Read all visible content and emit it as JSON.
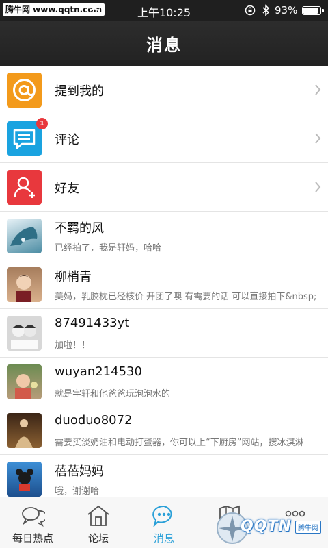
{
  "status_bar": {
    "site_label": "腾牛网 www.qqtn.com",
    "time": "上午10:25",
    "battery_pct": "93%",
    "battery_level": 0.93
  },
  "header": {
    "title": "消息"
  },
  "menu": [
    {
      "label": "提到我的",
      "icon": "at-icon",
      "color": "#f39a1b"
    },
    {
      "label": "评论",
      "icon": "comment-icon",
      "color": "#1aa3e0",
      "badge": "1"
    },
    {
      "label": "好友",
      "icon": "add-friend-icon",
      "color": "#e8383d"
    }
  ],
  "conversations": [
    {
      "name": "不羁的风",
      "preview": "已经拍了，我是轩妈，哈哈"
    },
    {
      "name": "柳梢青",
      "preview": "美妈，乳胶枕已经核价 开团了噢 有需要的话 可以直接拍下&nbsp;"
    },
    {
      "name": "87491433yt",
      "preview": "加啦！！"
    },
    {
      "name": "wuyan214530",
      "preview": "就是宇轩和他爸爸玩泡泡水的"
    },
    {
      "name": "duoduo8072",
      "preview": "需要买淡奶油和电动打蛋器，你可以上“下厨房”网站，搜冰淇淋"
    },
    {
      "name": "蓓蓓妈妈",
      "preview": "哦，谢谢哈"
    }
  ],
  "tabs": [
    {
      "label": "每日热点",
      "icon": "chat-bubbles-icon",
      "active": false
    },
    {
      "label": "论坛",
      "icon": "home-icon",
      "active": false
    },
    {
      "label": "消息",
      "icon": "message-icon",
      "active": true
    },
    {
      "label": "",
      "icon": "map-icon",
      "active": false
    },
    {
      "label": "",
      "icon": "more-icon",
      "active": false
    }
  ],
  "watermark": {
    "text": "QQTN",
    "badge": "腾牛网"
  },
  "colors": {
    "accent": "#2aa0d8",
    "header_bg": "#252525"
  }
}
